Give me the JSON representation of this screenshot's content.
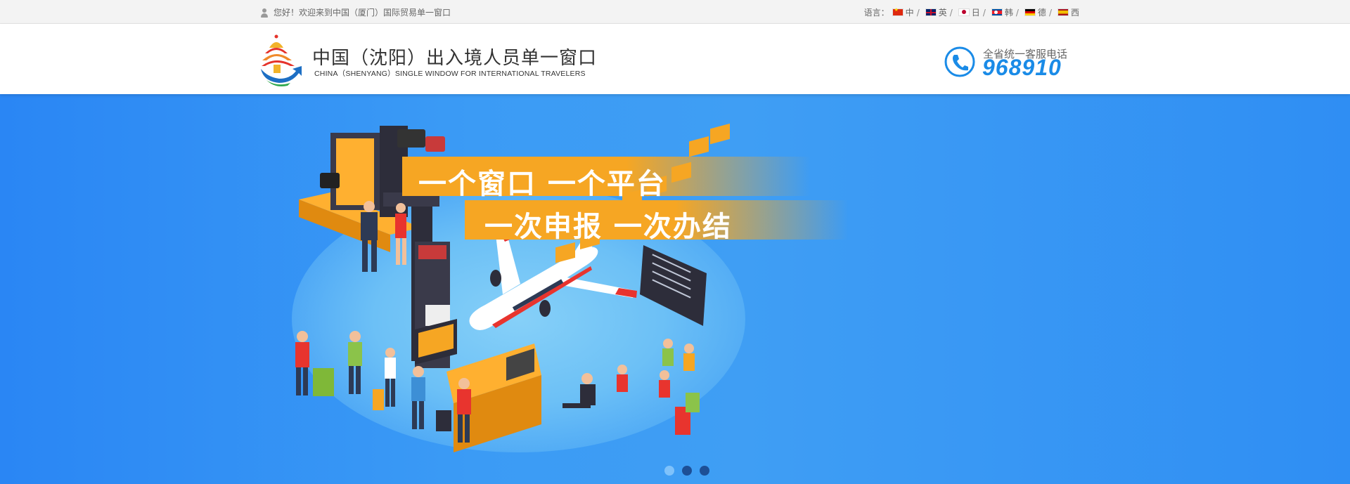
{
  "topbar": {
    "welcome": "您好！欢迎来到中国（厦门）国际贸易单一窗口",
    "language_label": "语言：",
    "languages": [
      {
        "label": "中",
        "flag": "flag-cn"
      },
      {
        "label": "英",
        "flag": "flag-gb"
      },
      {
        "label": "日",
        "flag": "flag-jp"
      },
      {
        "label": "韩",
        "flag": "flag-kp"
      },
      {
        "label": "德",
        "flag": "flag-de"
      },
      {
        "label": "西",
        "flag": "flag-es"
      }
    ]
  },
  "header": {
    "title": "中国（沈阳）出入境人员单一窗口",
    "subtitle": "CHINA（SHENYANG）SINGLE WINDOW FOR INTERNATIONAL TRAVELERS",
    "hotline_label": "全省统一客服电话",
    "hotline_number": "968910",
    "logo_icon": "temple-logo-icon",
    "phone_icon": "phone-icon"
  },
  "banner": {
    "slogan_line1": "一个窗口 一个平台",
    "slogan_line2": "一次申报 一次办结",
    "illustration": "airport-scene-illustration",
    "slides": 3,
    "active_slide": 0
  },
  "colors": {
    "accent": "#1a8be7",
    "banner_blue": "#3b9bf5",
    "slogan_orange": "#f6a623"
  }
}
